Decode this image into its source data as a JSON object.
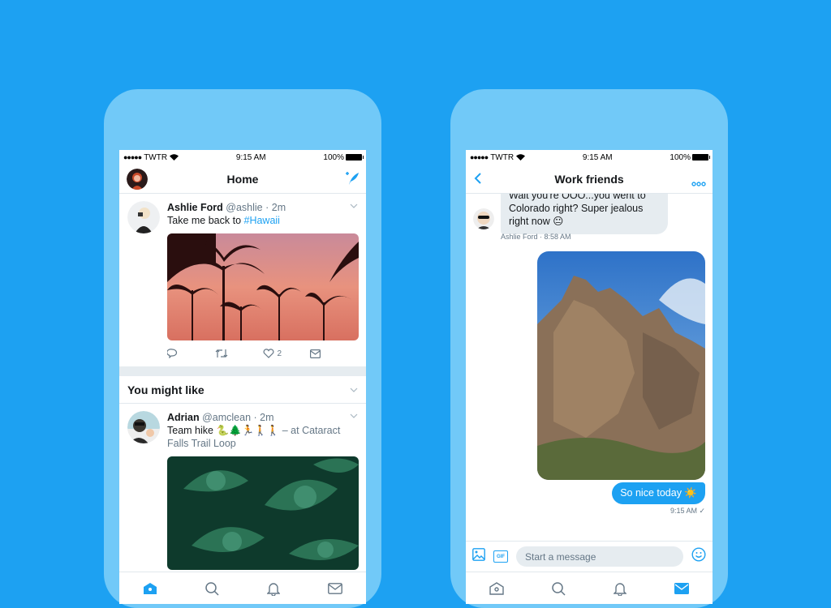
{
  "colors": {
    "background": "#1da1f2",
    "phone": "#71c9f8",
    "accent": "#1da1f2",
    "muted": "#657786"
  },
  "left_phone": {
    "status": {
      "carrier": "TWTR",
      "time": "9:15 AM",
      "battery": "100%"
    },
    "nav": {
      "title": "Home",
      "left_icon": "profile-avatar",
      "right_icon": "compose-tweet-icon"
    },
    "tweets": [
      {
        "name": "Ashlie Ford",
        "handle": "@ashlie",
        "time": "2m",
        "sep": "·",
        "text_pre": "Take me back to ",
        "hashtag": "#Hawaii",
        "media": "palm-trees-sunset-photo",
        "actions": {
          "reply": "",
          "retweet": "",
          "like": "2",
          "dm": ""
        }
      }
    ],
    "section": {
      "title": "You might like"
    },
    "suggested": {
      "name": "Adrian",
      "handle": "@amclean",
      "time": "2m",
      "sep": "·",
      "text": "Team hike 🐍🌲🏃🚶🚶",
      "location": "– at Cataract",
      "location2": "Falls Trail Loop",
      "media": "green-leaves-photo"
    },
    "tabs": [
      {
        "name": "home",
        "active": true
      },
      {
        "name": "search",
        "active": false
      },
      {
        "name": "notifications",
        "active": false
      },
      {
        "name": "messages",
        "active": false
      }
    ]
  },
  "right_phone": {
    "status": {
      "carrier": "TWTR",
      "time": "9:15 AM",
      "battery": "100%"
    },
    "nav": {
      "title": "Work friends",
      "back": "back-icon",
      "more": "more-icon"
    },
    "messages": [
      {
        "from": "Ashlie Ford",
        "text_line0": "Wait you're OOO...you went to",
        "text": "Colorado right? Super jealous right now 😐",
        "meta": "Ashlie Ford · 8:58 AM"
      },
      {
        "from": "me",
        "media": "rock-cliff-photo"
      },
      {
        "from": "me",
        "text": "So nice today ☀️",
        "meta": "9:15 AM ✓"
      }
    ],
    "composer": {
      "placeholder": "Start a message",
      "gif_label": "GIF"
    },
    "tabs": [
      {
        "name": "home",
        "active": false
      },
      {
        "name": "search",
        "active": false
      },
      {
        "name": "notifications",
        "active": false
      },
      {
        "name": "messages",
        "active": true
      }
    ]
  }
}
